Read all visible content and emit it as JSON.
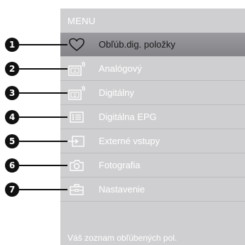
{
  "menu": {
    "title": "MENU",
    "items": [
      {
        "number": "1",
        "label": "Obľúb.dig. položky",
        "icon": "heart-icon",
        "selected": true
      },
      {
        "number": "2",
        "label": "Analógový",
        "icon": "tv-analog-icon",
        "badge": "A"
      },
      {
        "number": "3",
        "label": "Digitálny",
        "icon": "tv-digital-icon",
        "badge": "D"
      },
      {
        "number": "4",
        "label": "Digitálna EPG",
        "icon": "epg-list-icon"
      },
      {
        "number": "5",
        "label": "Externé vstupy",
        "icon": "external-input-icon"
      },
      {
        "number": "6",
        "label": "Fotografia",
        "icon": "camera-icon"
      },
      {
        "number": "7",
        "label": "Nastavenie",
        "icon": "toolbox-icon"
      }
    ],
    "footer_hint": "Váš zoznam obľúbených pol."
  },
  "colors": {
    "panel": "#cfcfd1",
    "selected_row": "#8f8f93",
    "callout": "#111111",
    "text": "#ffffff"
  }
}
